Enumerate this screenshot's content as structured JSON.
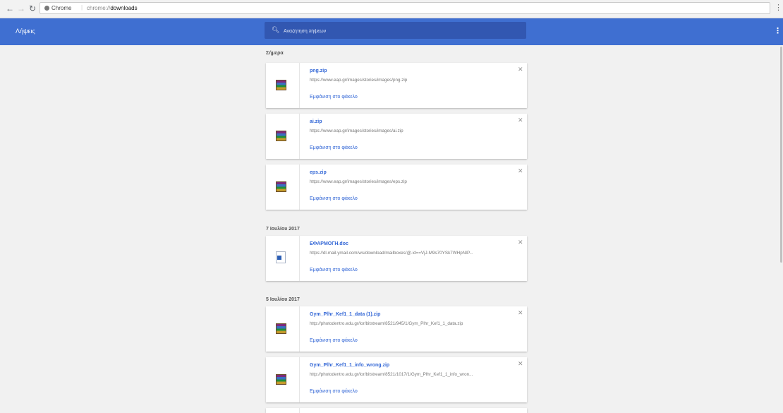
{
  "omnibar": {
    "secure_label": "Chrome",
    "separator": "|",
    "url_scheme": "chrome://",
    "url_path": "downloads"
  },
  "header": {
    "title": "Λήψεις",
    "search_placeholder": "Αναζήτηση λήψεων"
  },
  "groups": [
    {
      "date": "Σήμερα",
      "items": [
        {
          "name": "png.zip",
          "url": "https://www.eap.gr/images/stories/images/png.zip",
          "action": "Εμφάνιση στο φάκελο",
          "type": "zip"
        },
        {
          "name": "ai.zip",
          "url": "https://www.eap.gr/images/stories/images/ai.zip",
          "action": "Εμφάνιση στο φάκελο",
          "type": "zip"
        },
        {
          "name": "eps.zip",
          "url": "https://www.eap.gr/images/stories/images/eps.zip",
          "action": "Εμφάνιση στο φάκελο",
          "type": "zip"
        }
      ]
    },
    {
      "date": "7 Ιουλίου 2017",
      "items": [
        {
          "name": "ΕΦΑΡΜΟΓΗ.doc",
          "url": "https://dl-mail.ymail.com/ws/download/mailboxes/@.id==VjJ-M9s70YSk7WHpNIP...",
          "action": "Εμφάνιση στο φάκελο",
          "type": "doc"
        }
      ]
    },
    {
      "date": "5 Ιουλίου 2017",
      "items": [
        {
          "name": "Gym_Plhr_Kef1_1_data (1).zip",
          "url": "http://photodentro.edu.gr/lor/bitstream/8521/945/1/Gym_Plhr_Kef1_1_data.zip",
          "action": "Εμφάνιση στο φάκελο",
          "type": "zip"
        },
        {
          "name": "Gym_Plhr_Kef1_1_info_wrong.zip",
          "url": "http://photodentro.edu.gr/lor/bitstream/8521/1017/1/Gym_Plhr_Kef1_1_info_wron...",
          "action": "Εμφάνιση στο φάκελο",
          "type": "zip"
        }
      ]
    }
  ]
}
